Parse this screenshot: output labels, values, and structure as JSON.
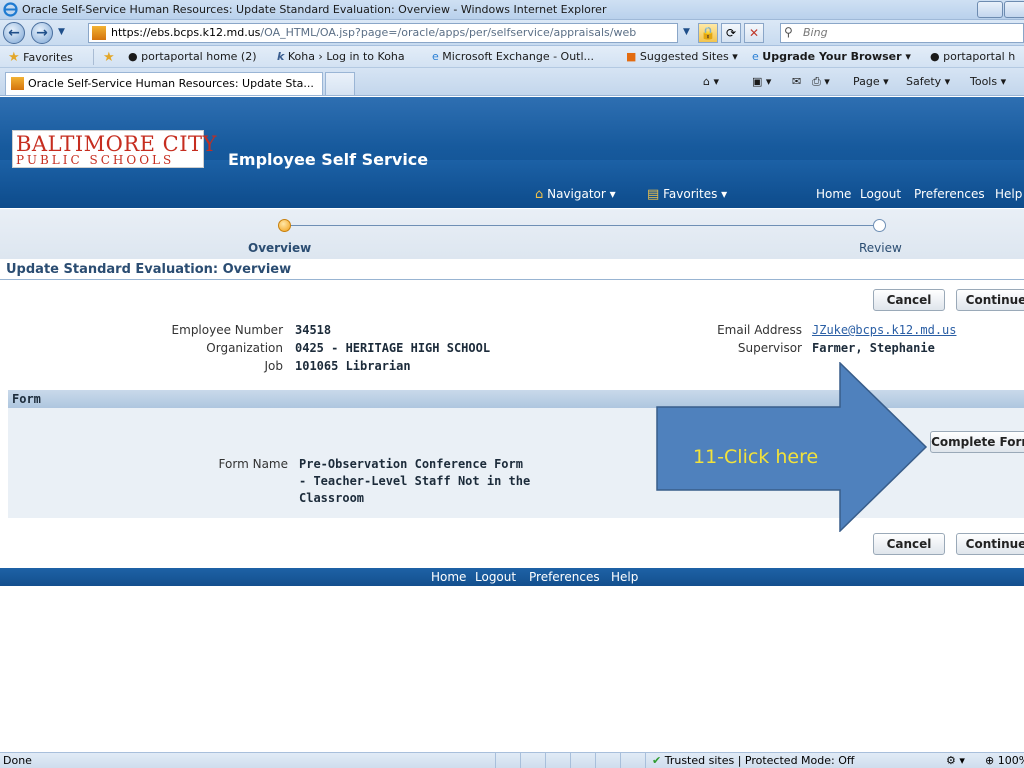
{
  "window": {
    "title": "Oracle Self-Service Human Resources: Update Standard Evaluation: Overview - Windows Internet Explorer"
  },
  "address_bar": {
    "url_host": "https://ebs.bcps.k12.md.us",
    "url_path": "/OA_HTML/OA.jsp?page=/oracle/apps/per/selfservice/appraisals/web",
    "search_placeholder": "Bing"
  },
  "favorites_bar": {
    "favorites_label": "Favorites",
    "items": [
      "portaportal home (2)",
      "Koha › Log in to Koha",
      "Microsoft Exchange - Outl...",
      "Suggested Sites ▾",
      "Upgrade Your Browser ▾",
      "portaportal h"
    ]
  },
  "tabs": {
    "active_tab": "Oracle Self-Service Human Resources: Update Sta..."
  },
  "toolbar": {
    "page": "Page ▾",
    "safety": "Safety ▾",
    "tools": "Tools ▾"
  },
  "header": {
    "logo_line1": "BALTIMORE CITY",
    "logo_line2": "PUBLIC SCHOOLS",
    "app_title": "Employee Self Service",
    "navigator": "Navigator ▾",
    "favorites": "Favorites ▾",
    "global_links": [
      "Home",
      "Logout",
      "Preferences",
      "Help"
    ]
  },
  "train": {
    "steps": [
      "Overview",
      "Review"
    ]
  },
  "page": {
    "title": "Update Standard Evaluation: Overview",
    "cancel": "Cancel",
    "continue": "Continue",
    "employee_number_label": "Employee Number",
    "employee_number": "34518",
    "organization_label": "Organization",
    "organization": "0425 - HERITAGE HIGH SCHOOL",
    "job_label": "Job",
    "job": "101065 Librarian",
    "email_label": "Email Address",
    "email": "JZuke@bcps.k12.md.us",
    "supervisor_label": "Supervisor",
    "supervisor": "Farmer, Stephanie"
  },
  "form": {
    "header": "Form",
    "form_name_label": "Form Name",
    "form_name_line1": "Pre-Observation Conference Form",
    "form_name_line2": "- Teacher-Level Staff Not in the",
    "form_name_line3": "Classroom",
    "complete_button": "Complete Form"
  },
  "callout": {
    "text": "11-Click here",
    "fill": "#4f81bd",
    "text_color": "#f2e23b"
  },
  "status": {
    "left": "Done",
    "zone": "Trusted sites | Protected Mode: Off",
    "zoom": "100%"
  }
}
